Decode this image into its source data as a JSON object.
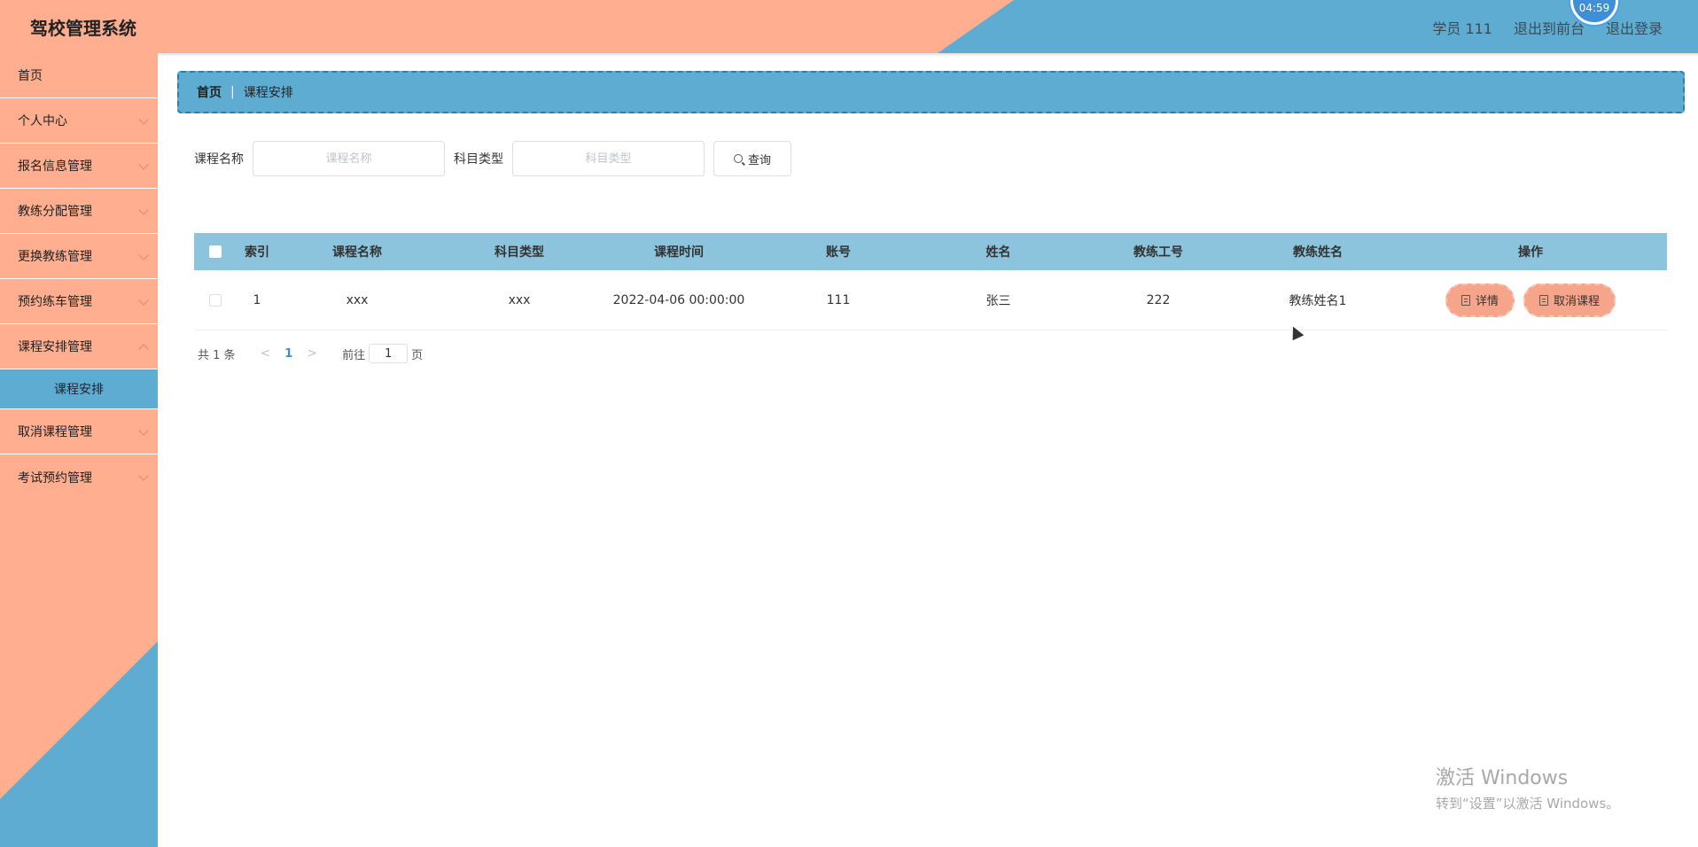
{
  "header": {
    "title": "驾校管理系统",
    "user_label": "学员 111",
    "to_front_label": "退出到前台",
    "logout_label": "退出登录",
    "clock": "04:59"
  },
  "sidebar": {
    "items": [
      {
        "label": "首页"
      },
      {
        "label": "个人中心"
      },
      {
        "label": "报名信息管理"
      },
      {
        "label": "教练分配管理"
      },
      {
        "label": "更换教练管理"
      },
      {
        "label": "预约练车管理"
      },
      {
        "label": "课程安排管理"
      },
      {
        "label": "取消课程管理"
      },
      {
        "label": "考试预约管理"
      }
    ],
    "active_sub": "课程安排"
  },
  "breadcrumb": {
    "home": "首页",
    "separator": "|",
    "current": "课程安排"
  },
  "search": {
    "course_name_label": "课程名称",
    "course_name_placeholder": "课程名称",
    "subject_type_label": "科目类型",
    "subject_type_placeholder": "科目类型",
    "query_label": "查询"
  },
  "table": {
    "headers": [
      "索引",
      "课程名称",
      "科目类型",
      "课程时间",
      "账号",
      "姓名",
      "教练工号",
      "教练姓名",
      "操作"
    ],
    "rows": [
      {
        "index": "1",
        "course_name": "xxx",
        "subject_type": "xxx",
        "course_time": "2022-04-06 00:00:00",
        "account": "111",
        "name": "张三",
        "coach_id": "222",
        "coach_name": "教练姓名1",
        "detail_label": "详情",
        "cancel_label": "取消课程"
      }
    ]
  },
  "pagination": {
    "total": "共 1 条",
    "prev": "<",
    "current": "1",
    "next": ">",
    "goto_label": "前往",
    "goto_value": "1",
    "page_unit": "页"
  },
  "watermark": {
    "title": "激活 Windows",
    "subtitle": "转到“设置”以激活 Windows。"
  },
  "colors": {
    "salmon": "#ffae90",
    "blue": "#5eacd2",
    "table_header": "#8cc3dd",
    "button": "#f7a58a"
  }
}
